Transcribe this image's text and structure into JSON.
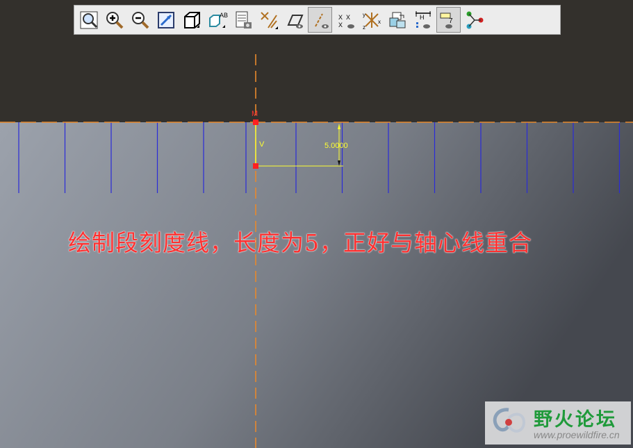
{
  "colors": {
    "top_bg": "#33302c",
    "grad_left": "#9aa0aa",
    "grad_right": "#4b4f56",
    "scale_line": "#2a2bd8",
    "centerline": "#e8892c",
    "sketch": "#ffff30",
    "point": "#ff2020",
    "caption": "#ff3030"
  },
  "toolbar": {
    "buttons": [
      {
        "name": "zoom-fit-icon",
        "active": false
      },
      {
        "name": "zoom-in-icon",
        "active": false
      },
      {
        "name": "zoom-out-icon",
        "active": false
      },
      {
        "name": "repaint-icon",
        "active": false
      },
      {
        "name": "display-style-icon",
        "active": false
      },
      {
        "name": "saved-views-icon",
        "active": false
      },
      {
        "name": "layers-icon",
        "active": false
      },
      {
        "name": "datum-axes-icon",
        "active": false
      },
      {
        "name": "datum-planes-icon",
        "active": false
      },
      {
        "name": "datum-axis-display-icon",
        "active": true
      },
      {
        "name": "datum-points-icon",
        "active": false
      },
      {
        "name": "csys-display-icon",
        "active": false
      },
      {
        "name": "annotations-icon",
        "active": false
      },
      {
        "name": "dimension-display-icon",
        "active": false
      },
      {
        "name": "constraint-display-icon",
        "active": true
      },
      {
        "name": "vertex-display-icon",
        "active": false
      }
    ]
  },
  "sketch": {
    "point_label": "M",
    "vertical_label": "V",
    "dimension_value": "5.0000"
  },
  "caption": "绘制段刻度线，长度为5，正好与轴心线重合",
  "watermark": {
    "title": "野火论坛",
    "url": "www.proewildfire.cn"
  }
}
